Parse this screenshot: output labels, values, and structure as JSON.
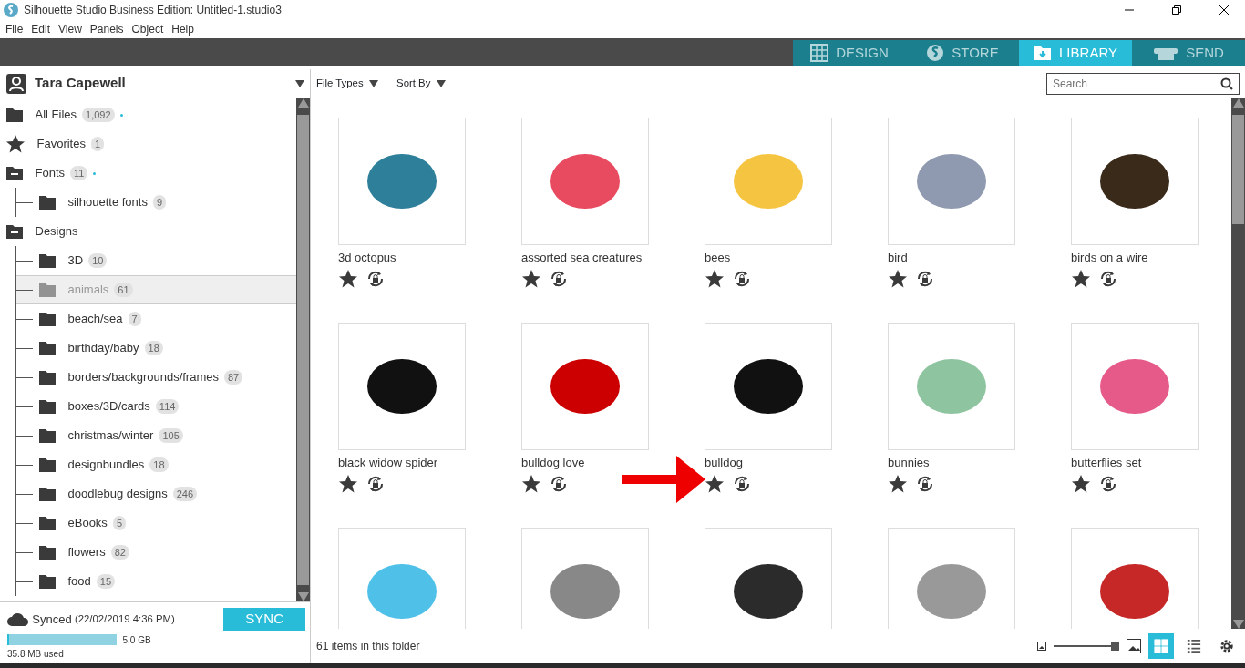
{
  "window": {
    "title": "Silhouette Studio Business Edition: Untitled-1.studio3"
  },
  "menu": [
    "File",
    "Edit",
    "View",
    "Panels",
    "Object",
    "Help"
  ],
  "tabs": [
    {
      "label": "DESIGN",
      "kind": "design",
      "selected": false
    },
    {
      "label": "STORE",
      "kind": "store",
      "selected": false
    },
    {
      "label": "LIBRARY",
      "kind": "library",
      "selected": true
    },
    {
      "label": "SEND",
      "kind": "send",
      "selected": false
    }
  ],
  "sidebar": {
    "user": "Tara Capewell",
    "tree": [
      {
        "name": "All Files",
        "count": "1,092",
        "kind": "folder",
        "sync_dot": true,
        "selected": false
      },
      {
        "name": "Favorites",
        "count": "1",
        "kind": "star",
        "selected": false
      },
      {
        "name": "Fonts",
        "count": "11",
        "kind": "folder",
        "expanded": true,
        "sync_dot": true,
        "selected": false,
        "children": [
          {
            "name": "silhouette fonts",
            "count": "9",
            "kind": "folder",
            "selected": false
          }
        ]
      },
      {
        "name": "Designs",
        "kind": "folder",
        "expanded": true,
        "selected": false,
        "children": [
          {
            "name": "3D",
            "count": "10",
            "kind": "folder",
            "selected": false
          },
          {
            "name": "animals",
            "count": "61",
            "kind": "folder",
            "selected": true
          },
          {
            "name": "beach/sea",
            "count": "7",
            "kind": "folder",
            "selected": false
          },
          {
            "name": "birthday/baby",
            "count": "18",
            "kind": "folder",
            "selected": false
          },
          {
            "name": "borders/backgrounds/frames",
            "count": "87",
            "kind": "folder",
            "selected": false
          },
          {
            "name": "boxes/3D/cards",
            "count": "114",
            "kind": "folder",
            "selected": false
          },
          {
            "name": "christmas/winter",
            "count": "105",
            "kind": "folder",
            "selected": false
          },
          {
            "name": "designbundles",
            "count": "18",
            "kind": "folder",
            "selected": false
          },
          {
            "name": "doodlebug designs",
            "count": "246",
            "kind": "folder",
            "selected": false
          },
          {
            "name": "eBooks",
            "count": "5",
            "kind": "folder",
            "selected": false
          },
          {
            "name": "flowers",
            "count": "82",
            "kind": "folder",
            "selected": false
          },
          {
            "name": "food",
            "count": "15",
            "kind": "folder",
            "selected": false
          }
        ]
      }
    ],
    "sync": {
      "status": "Synced",
      "time": "(22/02/2019 4:36 PM)",
      "button": "SYNC",
      "capacity": "5.0 GB",
      "used": "35.8 MB used",
      "level": 0.02
    }
  },
  "toolbar": {
    "file_types": "File Types",
    "sort_by": "Sort By",
    "search": {
      "placeholder": "Search"
    }
  },
  "designs": [
    {
      "kind": "tile",
      "name": "3d octopus"
    },
    {
      "kind": "tile",
      "name": "assorted sea creatures"
    },
    {
      "kind": "tile",
      "name": "bees"
    },
    {
      "kind": "tile",
      "name": "bird"
    },
    {
      "kind": "tile",
      "name": "birds on a wire"
    },
    {
      "kind": "tile",
      "name": "black widow spider"
    },
    {
      "kind": "tile",
      "name": "bulldog love"
    },
    {
      "kind": "tile",
      "name": "bulldog"
    },
    {
      "kind": "tile",
      "name": "bunnies"
    },
    {
      "kind": "tile",
      "name": "butterflies set"
    },
    {
      "kind": "cut"
    },
    {
      "kind": "cut"
    },
    {
      "kind": "cut"
    },
    {
      "kind": "cut"
    },
    {
      "kind": "cut"
    }
  ],
  "status_bar": {
    "text": "61 items in this folder",
    "zoom": {
      "level": 1
    },
    "views": [
      {
        "kind": "grid",
        "selected": true
      },
      {
        "kind": "list",
        "selected": false
      }
    ]
  }
}
